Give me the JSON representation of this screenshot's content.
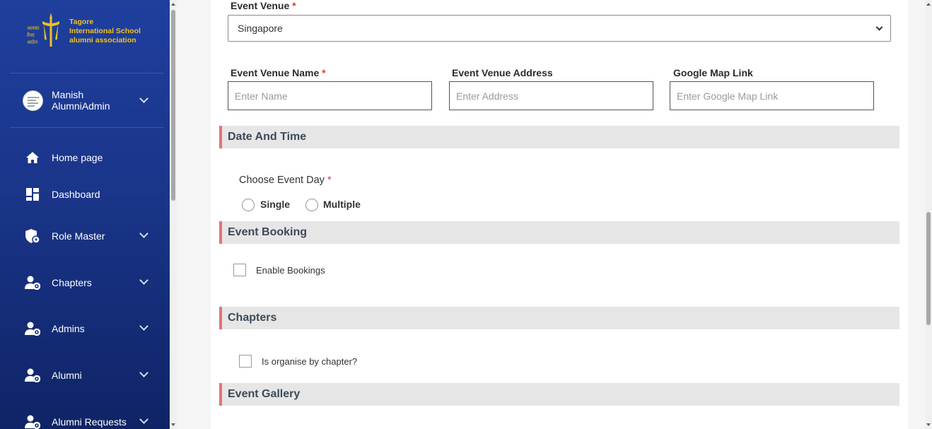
{
  "sidebar": {
    "logo": {
      "lines": [
        "Tagore",
        "International School",
        "alumni association"
      ],
      "mark_lines": [
        "अलका",
        "तैत्ता",
        "आठेन"
      ]
    },
    "user": {
      "first": "Manish",
      "second": "AlumniAdmin"
    },
    "items": [
      {
        "label": "Home page",
        "icon": "home-icon"
      },
      {
        "label": "Dashboard",
        "icon": "dashboard-icon"
      },
      {
        "label": "Role Master",
        "icon": "shield-user-icon"
      },
      {
        "label": "Chapters",
        "icon": "user-gear-icon"
      },
      {
        "label": "Admins",
        "icon": "user-gear-icon"
      },
      {
        "label": "Alumni",
        "icon": "user-gear-icon"
      },
      {
        "label": "Alumni Requests",
        "icon": "user-gear-icon"
      }
    ]
  },
  "form": {
    "venue": {
      "label": "Event Venue",
      "value": "Singapore"
    },
    "venue_name": {
      "label": "Event Venue Name",
      "placeholder": "Enter Name"
    },
    "venue_address": {
      "label": "Event Venue Address",
      "placeholder": "Enter Address"
    },
    "map_link": {
      "label": "Google Map Link",
      "placeholder": "Enter Google Map Link"
    },
    "required_mark": "*"
  },
  "sections": {
    "date_time": "Date And Time",
    "booking": "Event Booking",
    "chapters": "Chapters",
    "gallery": "Event Gallery"
  },
  "event_day": {
    "label": "Choose Event Day",
    "options": [
      "Single",
      "Multiple"
    ]
  },
  "booking": {
    "enable_label": "Enable Bookings"
  },
  "chapters": {
    "organise_label": "Is organise by chapter?"
  },
  "colors": {
    "sidebar_top": "#1f3f9e",
    "sidebar_bottom": "#0f2466",
    "logo_gold": "#f2c21b",
    "section_accent": "#e57373",
    "section_bg": "#e6e6e6",
    "required": "#e53935"
  }
}
